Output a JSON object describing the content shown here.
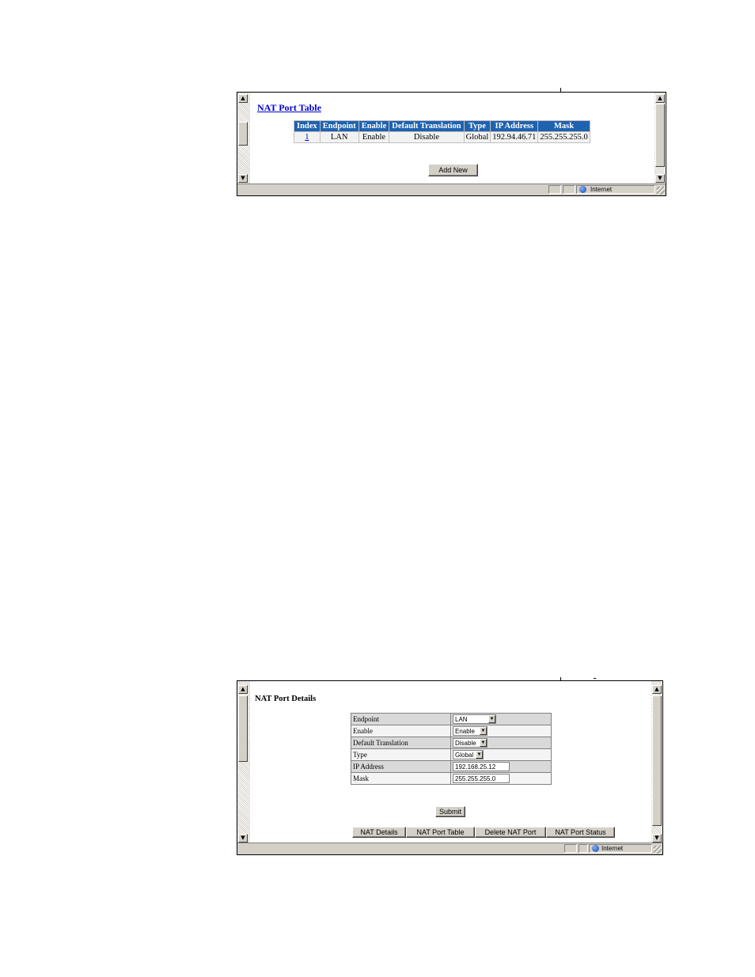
{
  "window1": {
    "title": "NAT Port Table",
    "table_headers": [
      "Index",
      "Endpoint",
      "Enable",
      "Default Translation",
      "Type",
      "IP Address",
      "Mask"
    ],
    "rows": [
      {
        "index": "1",
        "endpoint": "LAN",
        "enable": "Enable",
        "default_translation": "Disable",
        "type": "Global",
        "ip_address": "192.94.46.71",
        "mask": "255.255.255.0"
      }
    ],
    "add_new_label": "Add New",
    "status_zone": "Internet"
  },
  "window2": {
    "title": "NAT Port Details",
    "fields": {
      "endpoint": {
        "label": "Endpoint",
        "value": "LAN"
      },
      "enable": {
        "label": "Enable",
        "value": "Enable"
      },
      "default_translation": {
        "label": "Default Translation",
        "value": "Disable"
      },
      "type": {
        "label": "Type",
        "value": "Global"
      },
      "ip_address": {
        "label": "IP Address",
        "value": "192.168.25.12"
      },
      "mask": {
        "label": "Mask",
        "value": "255.255.255.0"
      }
    },
    "submit_label": "Submit",
    "nav_buttons": [
      "NAT Details",
      "NAT Port Table",
      "Delete NAT Port",
      "NAT Port Status"
    ],
    "status_zone": "Internet"
  },
  "icons": {
    "scroll_up": "scroll-up-arrow-icon",
    "scroll_down": "scroll-down-arrow-icon",
    "zone": "globe-icon",
    "dropdown": "chevron-down-icon"
  },
  "colors": {
    "header_bg": "#1f62b0",
    "link": "#0000cc"
  }
}
